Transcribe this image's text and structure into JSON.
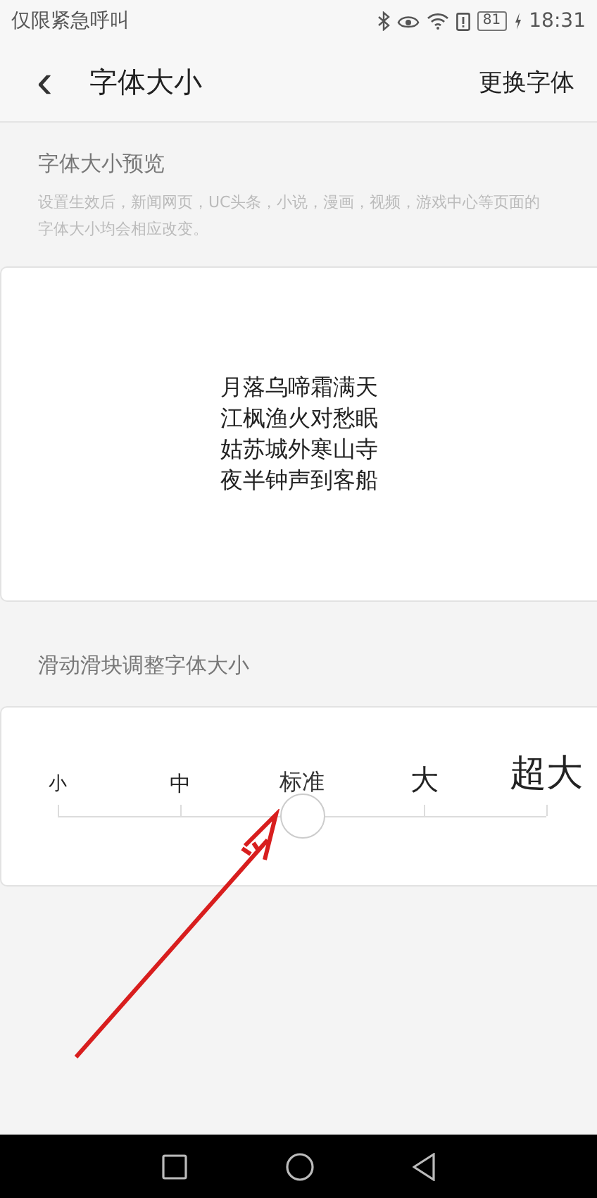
{
  "status_bar": {
    "carrier": "仅限紧急呼叫",
    "battery": "81",
    "time": "18:31"
  },
  "header": {
    "back": "‹",
    "title": "字体大小",
    "action": "更换字体"
  },
  "preview": {
    "title": "字体大小预览",
    "description": "设置生效后，新闻网页，UC头条，小说，漫画，视频，游戏中心等页面的字体大小均会相应改变。",
    "lines": [
      "月落乌啼霜满天",
      "江枫渔火对愁眠",
      "姑苏城外寒山寺",
      "夜半钟声到客船"
    ]
  },
  "slider": {
    "title": "滑动滑块调整字体大小",
    "level": 0.5,
    "stops": [
      {
        "label": "小",
        "selected": false
      },
      {
        "label": "中",
        "selected": false
      },
      {
        "label": "标准",
        "selected": true
      },
      {
        "label": "大",
        "selected": false
      },
      {
        "label": "超大",
        "selected": false
      }
    ]
  }
}
